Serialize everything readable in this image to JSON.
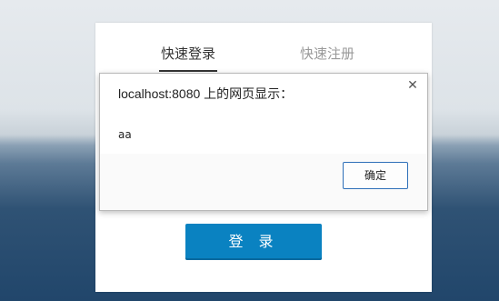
{
  "login_panel": {
    "tabs": [
      {
        "label": "快速登录",
        "active": true
      },
      {
        "label": "快速注册",
        "active": false
      }
    ],
    "login_button": "登 录"
  },
  "dialog": {
    "title": "localhost:8080 上的网页显示：",
    "message": "aa",
    "ok_button": "确定",
    "close_icon": "close-icon"
  },
  "colors": {
    "primary_button": "#0a82c1",
    "dialog_button_border": "#2d6fb8"
  }
}
